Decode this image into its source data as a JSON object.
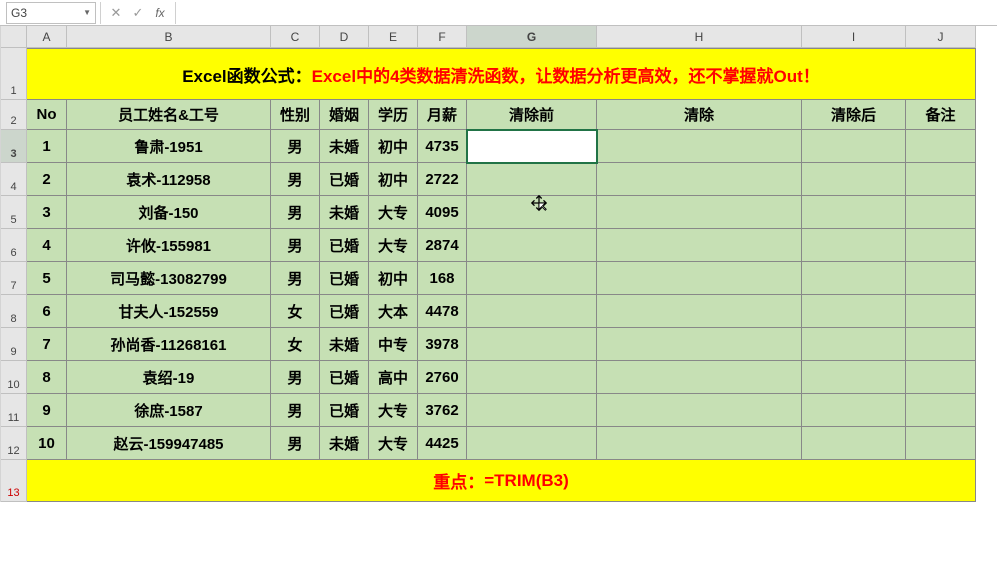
{
  "formula_bar": {
    "name_box": "G3",
    "cancel_glyph": "✕",
    "confirm_glyph": "✓",
    "fx_label": "fx",
    "formula": ""
  },
  "columns": [
    "A",
    "B",
    "C",
    "D",
    "E",
    "F",
    "G",
    "H",
    "I",
    "J"
  ],
  "row_numbers": [
    "1",
    "2",
    "3",
    "4",
    "5",
    "6",
    "7",
    "8",
    "9",
    "10",
    "11",
    "12",
    "13"
  ],
  "selected_column": "G",
  "selected_row": "3",
  "title": {
    "prefix": "Excel函数公式：",
    "main": "Excel中的4类数据清洗函数，让数据分析更高效，还不掌握就Out！"
  },
  "headers": {
    "no": "No",
    "name": "员工姓名&工号",
    "gender": "性别",
    "marriage": "婚姻",
    "education": "学历",
    "salary": "月薪",
    "before": "清除前",
    "clean": "清除",
    "after": "清除后",
    "note": "备注"
  },
  "rows": [
    {
      "no": "1",
      "name": "鲁肃-1951",
      "gender": "男",
      "marriage": "未婚",
      "education": "初中",
      "salary": "4735",
      "before": "",
      "clean": "",
      "after": "",
      "note": ""
    },
    {
      "no": "2",
      "name": "袁术-112958",
      "gender": "男",
      "marriage": "已婚",
      "education": "初中",
      "salary": "2722",
      "before": "",
      "clean": "",
      "after": "",
      "note": ""
    },
    {
      "no": "3",
      "name": "刘备-150",
      "gender": "男",
      "marriage": "未婚",
      "education": "大专",
      "salary": "4095",
      "before": "",
      "clean": "",
      "after": "",
      "note": ""
    },
    {
      "no": "4",
      "name": "许攸-155981",
      "gender": "男",
      "marriage": "已婚",
      "education": "大专",
      "salary": "2874",
      "before": "",
      "clean": "",
      "after": "",
      "note": ""
    },
    {
      "no": "5",
      "name": "司马懿-13082799",
      "gender": "男",
      "marriage": "已婚",
      "education": "初中",
      "salary": "168",
      "before": "",
      "clean": "",
      "after": "",
      "note": ""
    },
    {
      "no": "6",
      "name": "甘夫人-152559",
      "gender": "女",
      "marriage": "已婚",
      "education": "大本",
      "salary": "4478",
      "before": "",
      "clean": "",
      "after": "",
      "note": ""
    },
    {
      "no": "7",
      "name": "孙尚香-11268161",
      "gender": "女",
      "marriage": "未婚",
      "education": "中专",
      "salary": "3978",
      "before": "",
      "clean": "",
      "after": "",
      "note": ""
    },
    {
      "no": "8",
      "name": "袁绍-19",
      "gender": "男",
      "marriage": "已婚",
      "education": "高中",
      "salary": "2760",
      "before": "",
      "clean": "",
      "after": "",
      "note": ""
    },
    {
      "no": "9",
      "name": "徐庶-1587",
      "gender": "男",
      "marriage": "已婚",
      "education": "大专",
      "salary": "3762",
      "before": "",
      "clean": "",
      "after": "",
      "note": ""
    },
    {
      "no": "10",
      "name": "赵云-159947485",
      "gender": "男",
      "marriage": "未婚",
      "education": "大专",
      "salary": "4425",
      "before": "",
      "clean": "",
      "after": "",
      "note": ""
    }
  ],
  "footer": {
    "label": "重点：",
    "formula": "=TRIM(B3)"
  }
}
